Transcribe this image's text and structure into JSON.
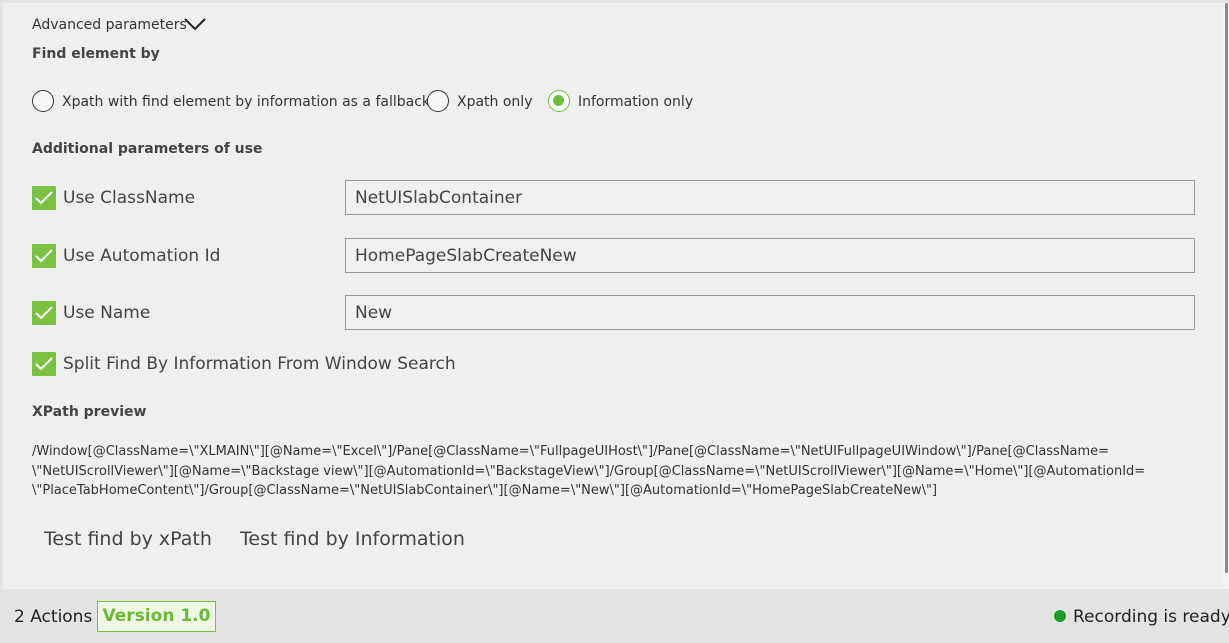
{
  "advanced": {
    "label": "Advanced parameters",
    "icon": "chevron-down-icon"
  },
  "find_element": {
    "heading": "Find element by",
    "options": [
      {
        "label": "Xpath with find element by information as a fallback",
        "selected": false
      },
      {
        "label": "Xpath only",
        "selected": false
      },
      {
        "label": "Information only",
        "selected": true
      }
    ]
  },
  "additional": {
    "heading": "Additional parameters of use",
    "params": [
      {
        "label": "Use ClassName",
        "checked": true,
        "value": "NetUISlabContainer"
      },
      {
        "label": "Use Automation Id",
        "checked": true,
        "value": "HomePageSlabCreateNew"
      },
      {
        "label": "Use Name",
        "checked": true,
        "value": "New"
      }
    ],
    "split": {
      "label": "Split Find By Information From Window Search",
      "checked": true
    }
  },
  "xpath_preview": {
    "heading": "XPath preview",
    "lines": [
      "/Window[@ClassName=\\\"XLMAIN\\\"][@Name=\\\"Excel\\\"]/Pane[@ClassName=\\\"FullpageUIHost\\\"]/Pane[@ClassName=\\\"NetUIFullpageUIWindow\\\"]/Pane[@ClassName=",
      "\\\"NetUIScrollViewer\\\"][@Name=\\\"Backstage view\\\"][@AutomationId=\\\"BackstageView\\\"]/Group[@ClassName=\\\"NetUIScrollViewer\\\"][@Name=\\\"Home\\\"][@AutomationId=",
      "\\\"PlaceTabHomeContent\\\"]/Group[@ClassName=\\\"NetUISlabContainer\\\"][@Name=\\\"New\\\"][@AutomationId=\\\"HomePageSlabCreateNew\\\"]"
    ]
  },
  "buttons": {
    "test_xpath": "Test find by xPath",
    "test_info": "Test find by Information"
  },
  "footer": {
    "actions": "2 Actions",
    "version": "Version 1.0",
    "status": "Recording is ready",
    "status_color": "#1f9d2a"
  },
  "colors": {
    "accent": "#7cc242",
    "background": "#efefef"
  }
}
